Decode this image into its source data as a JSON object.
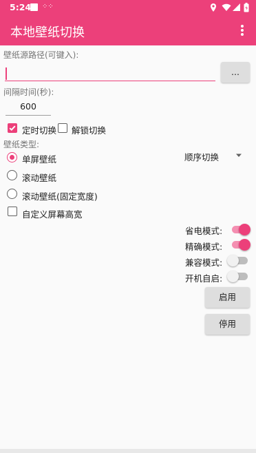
{
  "status_bar": {
    "time": "5:24"
  },
  "app_bar": {
    "title": "本地壁纸切换",
    "menu_icon": "more-vert-icon"
  },
  "path": {
    "label": "壁纸源路径(可键入):",
    "value": "",
    "browse_label": "..."
  },
  "interval": {
    "label": "间隔时间(秒):",
    "value": "600"
  },
  "options": {
    "timed_switch": {
      "label": "定时切换",
      "checked": true
    },
    "unlock_switch": {
      "label": "解锁切换",
      "checked": false
    }
  },
  "wallpaper_type": {
    "label": "壁纸类型:",
    "items": [
      {
        "label": "单屏壁纸",
        "selected": true
      },
      {
        "label": "滚动壁纸",
        "selected": false
      },
      {
        "label": "滚动壁纸(固定宽度)",
        "selected": false
      }
    ],
    "order_select": {
      "value": "顺序切换"
    }
  },
  "custom_screen": {
    "label": "自定义屏幕高宽",
    "checked": false
  },
  "toggles": [
    {
      "label": "省电模式:",
      "on": true
    },
    {
      "label": "精确模式:",
      "on": true
    },
    {
      "label": "兼容模式:",
      "on": false
    },
    {
      "label": "开机自启:",
      "on": false
    }
  ],
  "buttons": {
    "enable": "启用",
    "disable": "停用"
  },
  "colors": {
    "accent": "#ec407a",
    "accent_light": "#f48fb1"
  }
}
